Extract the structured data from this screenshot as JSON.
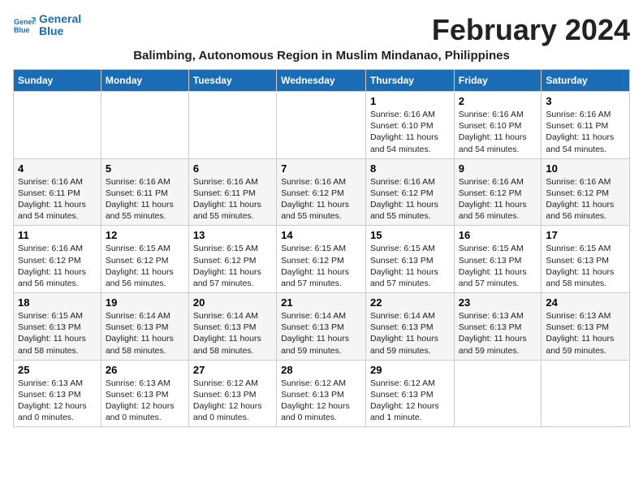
{
  "header": {
    "logo_line1": "General",
    "logo_line2": "Blue",
    "title": "February 2024",
    "subtitle": "Balimbing, Autonomous Region in Muslim Mindanao, Philippines"
  },
  "columns": [
    "Sunday",
    "Monday",
    "Tuesday",
    "Wednesday",
    "Thursday",
    "Friday",
    "Saturday"
  ],
  "weeks": [
    [
      {
        "day": "",
        "text": ""
      },
      {
        "day": "",
        "text": ""
      },
      {
        "day": "",
        "text": ""
      },
      {
        "day": "",
        "text": ""
      },
      {
        "day": "1",
        "text": "Sunrise: 6:16 AM\nSunset: 6:10 PM\nDaylight: 11 hours\nand 54 minutes."
      },
      {
        "day": "2",
        "text": "Sunrise: 6:16 AM\nSunset: 6:10 PM\nDaylight: 11 hours\nand 54 minutes."
      },
      {
        "day": "3",
        "text": "Sunrise: 6:16 AM\nSunset: 6:11 PM\nDaylight: 11 hours\nand 54 minutes."
      }
    ],
    [
      {
        "day": "4",
        "text": "Sunrise: 6:16 AM\nSunset: 6:11 PM\nDaylight: 11 hours\nand 54 minutes."
      },
      {
        "day": "5",
        "text": "Sunrise: 6:16 AM\nSunset: 6:11 PM\nDaylight: 11 hours\nand 55 minutes."
      },
      {
        "day": "6",
        "text": "Sunrise: 6:16 AM\nSunset: 6:11 PM\nDaylight: 11 hours\nand 55 minutes."
      },
      {
        "day": "7",
        "text": "Sunrise: 6:16 AM\nSunset: 6:12 PM\nDaylight: 11 hours\nand 55 minutes."
      },
      {
        "day": "8",
        "text": "Sunrise: 6:16 AM\nSunset: 6:12 PM\nDaylight: 11 hours\nand 55 minutes."
      },
      {
        "day": "9",
        "text": "Sunrise: 6:16 AM\nSunset: 6:12 PM\nDaylight: 11 hours\nand 56 minutes."
      },
      {
        "day": "10",
        "text": "Sunrise: 6:16 AM\nSunset: 6:12 PM\nDaylight: 11 hours\nand 56 minutes."
      }
    ],
    [
      {
        "day": "11",
        "text": "Sunrise: 6:16 AM\nSunset: 6:12 PM\nDaylight: 11 hours\nand 56 minutes."
      },
      {
        "day": "12",
        "text": "Sunrise: 6:15 AM\nSunset: 6:12 PM\nDaylight: 11 hours\nand 56 minutes."
      },
      {
        "day": "13",
        "text": "Sunrise: 6:15 AM\nSunset: 6:12 PM\nDaylight: 11 hours\nand 57 minutes."
      },
      {
        "day": "14",
        "text": "Sunrise: 6:15 AM\nSunset: 6:12 PM\nDaylight: 11 hours\nand 57 minutes."
      },
      {
        "day": "15",
        "text": "Sunrise: 6:15 AM\nSunset: 6:13 PM\nDaylight: 11 hours\nand 57 minutes."
      },
      {
        "day": "16",
        "text": "Sunrise: 6:15 AM\nSunset: 6:13 PM\nDaylight: 11 hours\nand 57 minutes."
      },
      {
        "day": "17",
        "text": "Sunrise: 6:15 AM\nSunset: 6:13 PM\nDaylight: 11 hours\nand 58 minutes."
      }
    ],
    [
      {
        "day": "18",
        "text": "Sunrise: 6:15 AM\nSunset: 6:13 PM\nDaylight: 11 hours\nand 58 minutes."
      },
      {
        "day": "19",
        "text": "Sunrise: 6:14 AM\nSunset: 6:13 PM\nDaylight: 11 hours\nand 58 minutes."
      },
      {
        "day": "20",
        "text": "Sunrise: 6:14 AM\nSunset: 6:13 PM\nDaylight: 11 hours\nand 58 minutes."
      },
      {
        "day": "21",
        "text": "Sunrise: 6:14 AM\nSunset: 6:13 PM\nDaylight: 11 hours\nand 59 minutes."
      },
      {
        "day": "22",
        "text": "Sunrise: 6:14 AM\nSunset: 6:13 PM\nDaylight: 11 hours\nand 59 minutes."
      },
      {
        "day": "23",
        "text": "Sunrise: 6:13 AM\nSunset: 6:13 PM\nDaylight: 11 hours\nand 59 minutes."
      },
      {
        "day": "24",
        "text": "Sunrise: 6:13 AM\nSunset: 6:13 PM\nDaylight: 11 hours\nand 59 minutes."
      }
    ],
    [
      {
        "day": "25",
        "text": "Sunrise: 6:13 AM\nSunset: 6:13 PM\nDaylight: 12 hours\nand 0 minutes."
      },
      {
        "day": "26",
        "text": "Sunrise: 6:13 AM\nSunset: 6:13 PM\nDaylight: 12 hours\nand 0 minutes."
      },
      {
        "day": "27",
        "text": "Sunrise: 6:12 AM\nSunset: 6:13 PM\nDaylight: 12 hours\nand 0 minutes."
      },
      {
        "day": "28",
        "text": "Sunrise: 6:12 AM\nSunset: 6:13 PM\nDaylight: 12 hours\nand 0 minutes."
      },
      {
        "day": "29",
        "text": "Sunrise: 6:12 AM\nSunset: 6:13 PM\nDaylight: 12 hours\nand 1 minute."
      },
      {
        "day": "",
        "text": ""
      },
      {
        "day": "",
        "text": ""
      }
    ]
  ]
}
